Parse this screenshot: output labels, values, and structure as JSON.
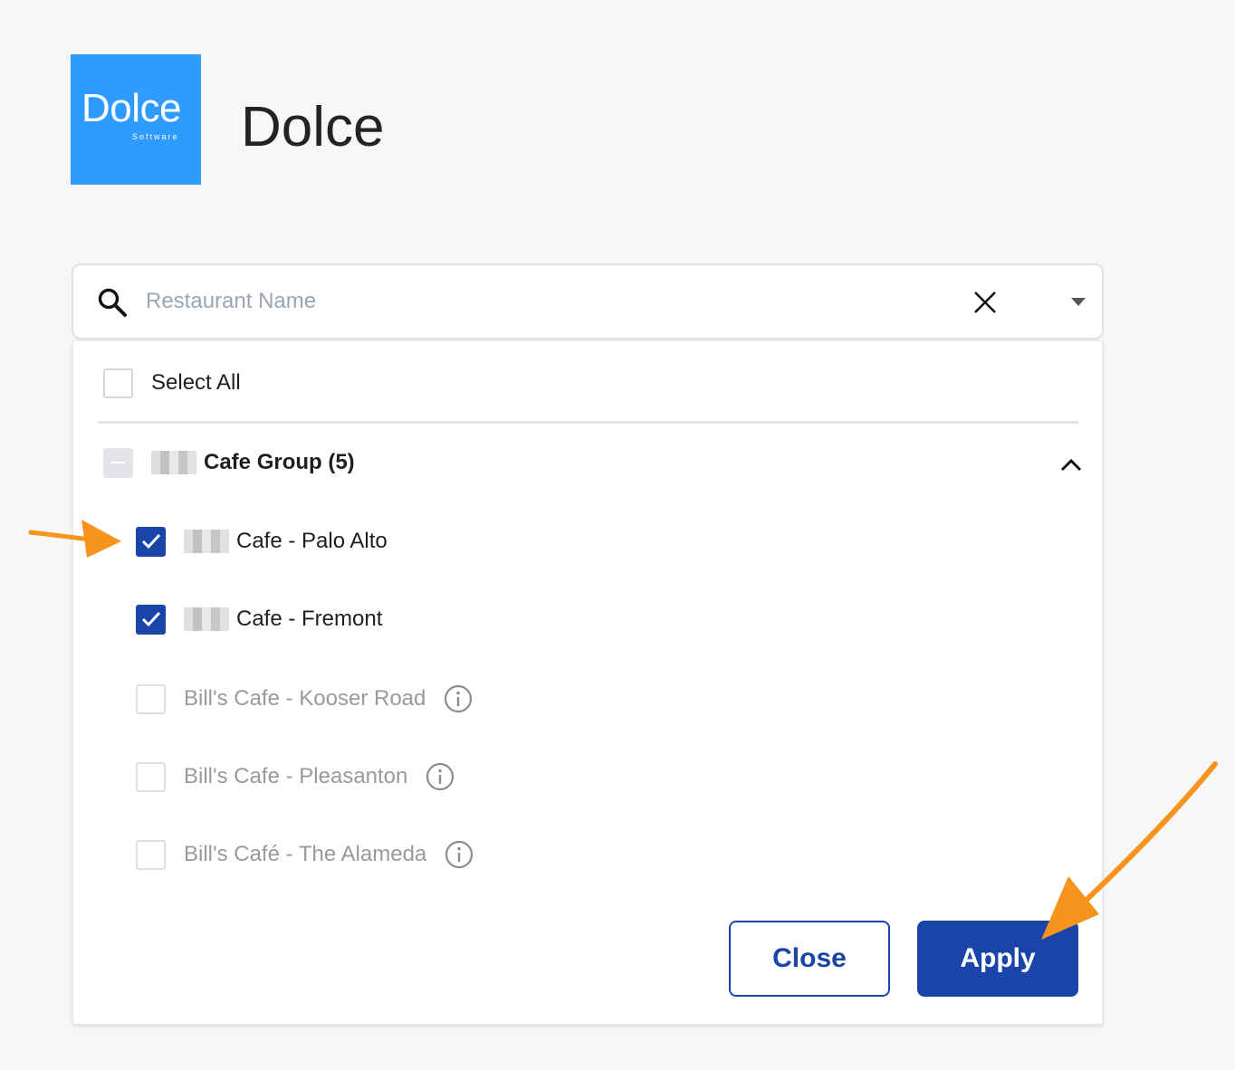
{
  "header": {
    "logo_text": "Dolce",
    "logo_subtext": "Software",
    "title": "Dolce"
  },
  "search": {
    "placeholder": "Restaurant Name",
    "value": ""
  },
  "list": {
    "select_all_label": "Select All",
    "group": {
      "label": "Cafe Group (5)",
      "state": "indeterminate",
      "expanded": true
    },
    "items": [
      {
        "label": "Cafe - Palo Alto",
        "checked": true,
        "disabled": false
      },
      {
        "label": "Cafe - Fremont",
        "checked": true,
        "disabled": false
      },
      {
        "label": "Bill's Cafe - Kooser Road",
        "checked": false,
        "disabled": true
      },
      {
        "label": "Bill's Cafe - Pleasanton",
        "checked": false,
        "disabled": true
      },
      {
        "label": "Bill's Café - The Alameda",
        "checked": false,
        "disabled": true
      }
    ]
  },
  "buttons": {
    "close_label": "Close",
    "apply_label": "Apply"
  },
  "colors": {
    "brand_blue": "#2f9bff",
    "primary": "#1a45a8",
    "annotation": "#f7941d"
  },
  "icons": {
    "search": "search-icon",
    "clear": "close-icon",
    "dropdown": "caret-down-icon",
    "collapse": "chevron-up-icon",
    "check": "check-icon",
    "info": "info-icon"
  }
}
